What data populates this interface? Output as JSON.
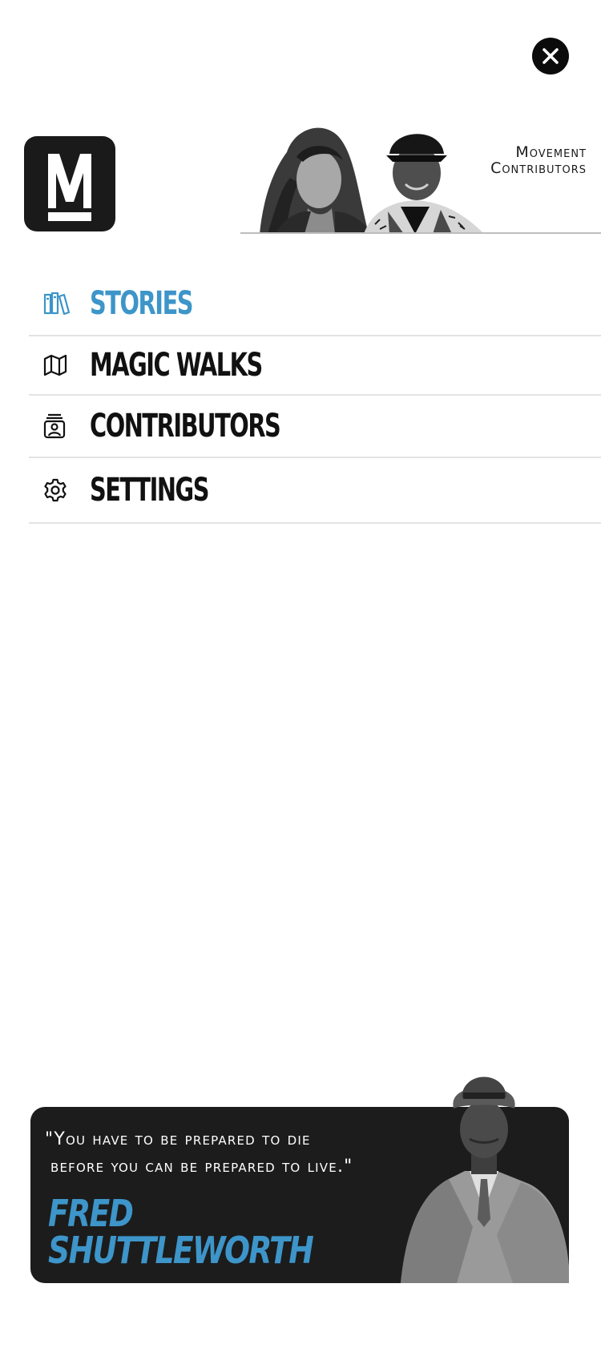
{
  "close": {
    "label": "Close"
  },
  "logo": {
    "letter": "M"
  },
  "banner": {
    "line1": "Movement",
    "line2": "Contributors"
  },
  "nav": {
    "items": [
      {
        "label": "STORIES",
        "icon": "books-icon",
        "active": true
      },
      {
        "label": "MAGIC WALKS",
        "icon": "map-icon",
        "active": false
      },
      {
        "label": "CONTRIBUTORS",
        "icon": "contact-card-icon",
        "active": false
      },
      {
        "label": "SETTINGS",
        "icon": "gear-icon",
        "active": false
      }
    ]
  },
  "quote": {
    "line1": "\"You have to be prepared to die",
    "line2": "before you can be prepared to live.\"",
    "author_first": "Fred",
    "author_last": "Shuttleworth"
  },
  "colors": {
    "accent": "#3d95c9",
    "dark": "#1c1c1c"
  }
}
